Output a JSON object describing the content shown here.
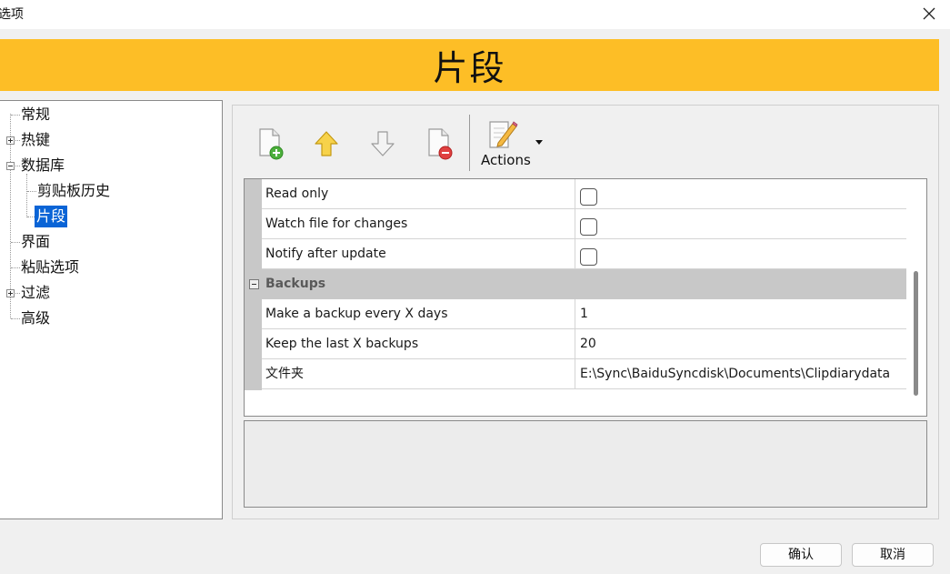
{
  "window": {
    "title": "选项",
    "close_icon": "close-icon"
  },
  "banner": {
    "title": "片段",
    "color": "#fdbe26"
  },
  "tree": {
    "items": [
      {
        "label": "常规",
        "expandable": false,
        "selected": false
      },
      {
        "label": "热键",
        "expandable": true,
        "expanded": false,
        "selected": false
      },
      {
        "label": "数据库",
        "expandable": true,
        "expanded": true,
        "selected": false
      },
      {
        "label": "剪贴板历史",
        "expandable": false,
        "selected": false
      },
      {
        "label": "片段",
        "expandable": false,
        "selected": true
      },
      {
        "label": "界面",
        "expandable": false,
        "selected": false
      },
      {
        "label": "粘贴选项",
        "expandable": false,
        "selected": false
      },
      {
        "label": "过滤",
        "expandable": true,
        "expanded": false,
        "selected": false
      },
      {
        "label": "高级",
        "expandable": false,
        "selected": false
      }
    ],
    "selected_color": "#0a64d6"
  },
  "toolbar": {
    "add_icon": "add-page-icon",
    "up_icon": "arrow-up-icon",
    "down_icon": "arrow-down-icon",
    "remove_icon": "remove-page-icon",
    "actions_icon": "edit-note-icon",
    "actions_label": "Actions"
  },
  "grid": {
    "rows": [
      {
        "name": "Read only",
        "type": "checkbox",
        "checked": false
      },
      {
        "name": "Watch file for changes",
        "type": "checkbox",
        "checked": false
      },
      {
        "name": "Notify after update",
        "type": "checkbox",
        "checked": false
      }
    ],
    "group": {
      "label": "Backups",
      "expanded": true,
      "rows": [
        {
          "name": "Make a backup every X days",
          "value": "1"
        },
        {
          "name": "Keep the last X backups",
          "value": "20"
        },
        {
          "name": "文件夹",
          "value": "E:\\Sync\\BaiduSyncdisk\\Documents\\Clipdiarydata"
        }
      ]
    }
  },
  "buttons": {
    "ok": "确认",
    "cancel": "取消"
  }
}
